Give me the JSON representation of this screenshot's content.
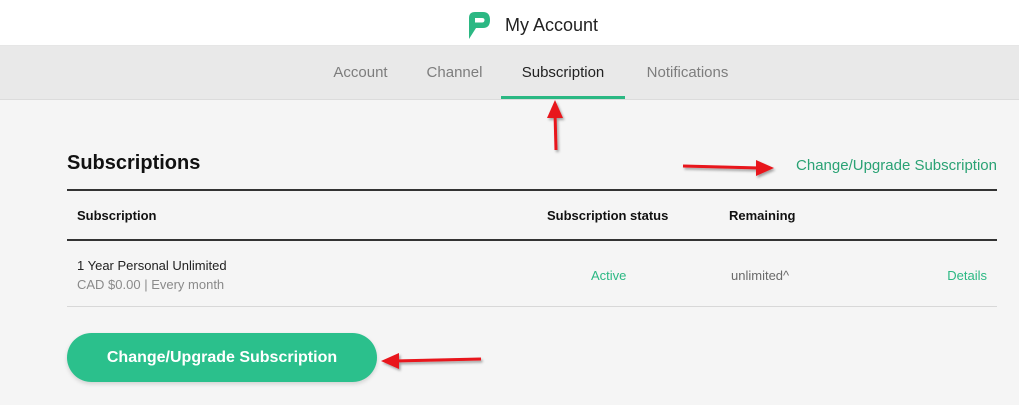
{
  "header": {
    "logo_icon": "p-speech-logo-icon",
    "title": "My Account"
  },
  "tabs": [
    {
      "label": "Account",
      "active": false
    },
    {
      "label": "Channel",
      "active": false
    },
    {
      "label": "Subscription",
      "active": true
    },
    {
      "label": "Notifications",
      "active": false
    }
  ],
  "section": {
    "title": "Subscriptions",
    "change_link": "Change/Upgrade Subscription"
  },
  "table": {
    "columns": [
      "Subscription",
      "Subscription status",
      "Remaining"
    ],
    "rows": [
      {
        "name": "1 Year Personal Unlimited",
        "price": "CAD $0.00 | Every month",
        "status": "Active",
        "remaining": "unlimited^",
        "action": "Details"
      }
    ]
  },
  "primary_button": "Change/Upgrade Subscription",
  "colors": {
    "accent": "#2bb883",
    "link": "#2aa274",
    "annotation_arrow": "#e8141b"
  },
  "annotations": [
    "red-arrow-icon",
    "red-arrow-icon",
    "red-arrow-icon"
  ]
}
